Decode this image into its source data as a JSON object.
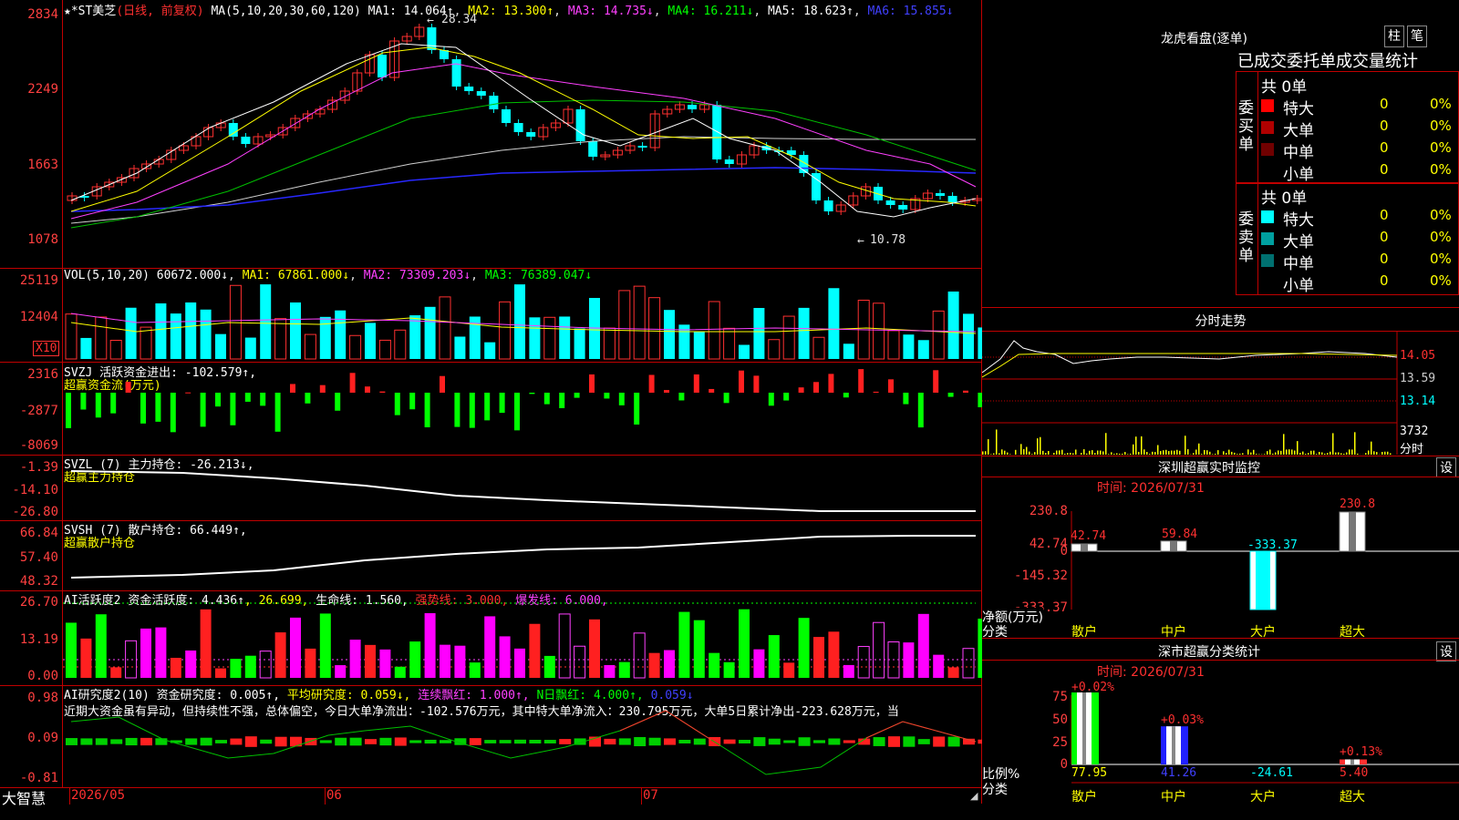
{
  "app": {
    "name": "大智慧"
  },
  "colors": {
    "up": "#ff3030",
    "down": "#00ffff",
    "grid": "#c00000",
    "bg": "#000000"
  },
  "main": {
    "stock_label": "★*ST美芝",
    "period_label": "(日线, 前复权)",
    "ma_label": "MA(5,10,20,30,60,120)",
    "ma1": "MA1: 14.064↑",
    "ma2": "MA2: 13.300↑",
    "ma3": "MA3: 14.735↓",
    "ma4": "MA4: 16.211↓",
    "ma5": "MA5: 18.623↑",
    "ma6": "MA6: 15.855↓",
    "yticks": [
      "2834",
      "2249",
      "1663",
      "1078"
    ],
    "high_label": "28.34",
    "low_label": "10.78"
  },
  "vol": {
    "label": "VOL(5,10,20)",
    "value": "60672.000↓",
    "ma1": "MA1: 67861.000↓",
    "ma2": "MA2: 73309.203↓",
    "ma3": "MA3: 76389.047↓",
    "yticks": [
      "25119",
      "12404"
    ],
    "unit": "X10"
  },
  "svzj": {
    "label": "SVZJ",
    "value": "活跃资金进出: -102.579↑,",
    "subtitle": "超赢资金流(万元)",
    "yticks": [
      "2316",
      "-2877",
      "-8069"
    ]
  },
  "svzl": {
    "label": "SVZL (7)",
    "value": "主力持仓: -26.213↓,",
    "subtitle": "超赢主力持仓",
    "yticks": [
      "-1.39",
      "-14.10",
      "-26.80"
    ]
  },
  "svsh": {
    "label": "SVSH (7)",
    "value": "散户持仓: 66.449↑,",
    "subtitle": "超赢散户持仓",
    "yticks": [
      "66.84",
      "57.40",
      "48.32"
    ]
  },
  "ai_active": {
    "label": "AI活跃度2",
    "v1": "资金活跃度: 4.436↑",
    "v2": ", 26.699,",
    "v3": "生命线: 1.560,",
    "v4": "强势线: 3.000,",
    "v5": "爆发线: 6.000,",
    "yticks": [
      "26.70",
      "13.19",
      "0.00"
    ]
  },
  "ai_research": {
    "label": "AI研究度2(10)",
    "v1": "资金研究度: 0.005↑,",
    "v2": "平均研究度: 0.059↓,",
    "v3": "连续飘红: 1.000↑,",
    "v4": "N日飘红: 4.000↑,",
    "v5": "0.059↓",
    "comment": "近期大资金虽有异动，但持续性不强，总体偏空，今日大单净流出：-102.576万元，其中特大单净流入：230.795万元，大单5日累计净出-223.628万元，当",
    "yticks": [
      "0.98",
      "0.09",
      "-0.81"
    ]
  },
  "xaxis": {
    "labels": [
      "2026/05",
      "06",
      "07"
    ]
  },
  "lhb": {
    "title": "龙虎看盘(逐单)",
    "tab1": "柱",
    "tab2": "笔",
    "header": "已成交委托单成交量统计",
    "buy_label": "委买单",
    "sell_label": "委卖单",
    "buy_total": "共 0单",
    "sell_total": "共 0单",
    "buy_rows": [
      {
        "name": "特大",
        "count": "0",
        "pct": "0%"
      },
      {
        "name": "大单",
        "count": "0",
        "pct": "0%"
      },
      {
        "name": "中单",
        "count": "0",
        "pct": "0%"
      },
      {
        "name": "小单",
        "count": "0",
        "pct": "0%"
      }
    ],
    "sell_rows": [
      {
        "name": "特大",
        "count": "0",
        "pct": "0%"
      },
      {
        "name": "大单",
        "count": "0",
        "pct": "0%"
      },
      {
        "name": "中单",
        "count": "0",
        "pct": "0%"
      },
      {
        "name": "小单",
        "count": "0",
        "pct": "0%"
      }
    ]
  },
  "intraday": {
    "title": "分时走势",
    "yticks": [
      "14.05",
      "13.59",
      "13.14"
    ],
    "vol_tick": "3732",
    "vol_label": "分时"
  },
  "sz_monitor": {
    "title": "深圳超赢实时监控",
    "btn": "设",
    "time": "时间: 2026/07/31",
    "yticks": [
      "230.8",
      "42.74",
      "0",
      "-145.32",
      "-333.37"
    ],
    "ylabel": "净额(万元)",
    "xlabel": "分类",
    "categories": [
      "散户",
      "中户",
      "大户",
      "超大"
    ],
    "values": [
      42.74,
      59.84,
      -333.37,
      230.8
    ],
    "value_labels": [
      "42.74",
      "59.84",
      "-333.37",
      "230.8"
    ]
  },
  "sz_stats": {
    "title": "深市超赢分类统计",
    "btn": "设",
    "time": "时间: 2026/07/31",
    "yticks": [
      "75",
      "50",
      "25",
      "0"
    ],
    "ylabel": "比例%",
    "xlabel": "分类",
    "categories": [
      "散户",
      "中户",
      "大户",
      "超大"
    ],
    "pct_labels": [
      "+0.02%",
      "+0.03%",
      "",
      "+0.13%"
    ],
    "values": [
      "77.95",
      "41.26",
      "-24.61",
      "5.40"
    ]
  }
}
